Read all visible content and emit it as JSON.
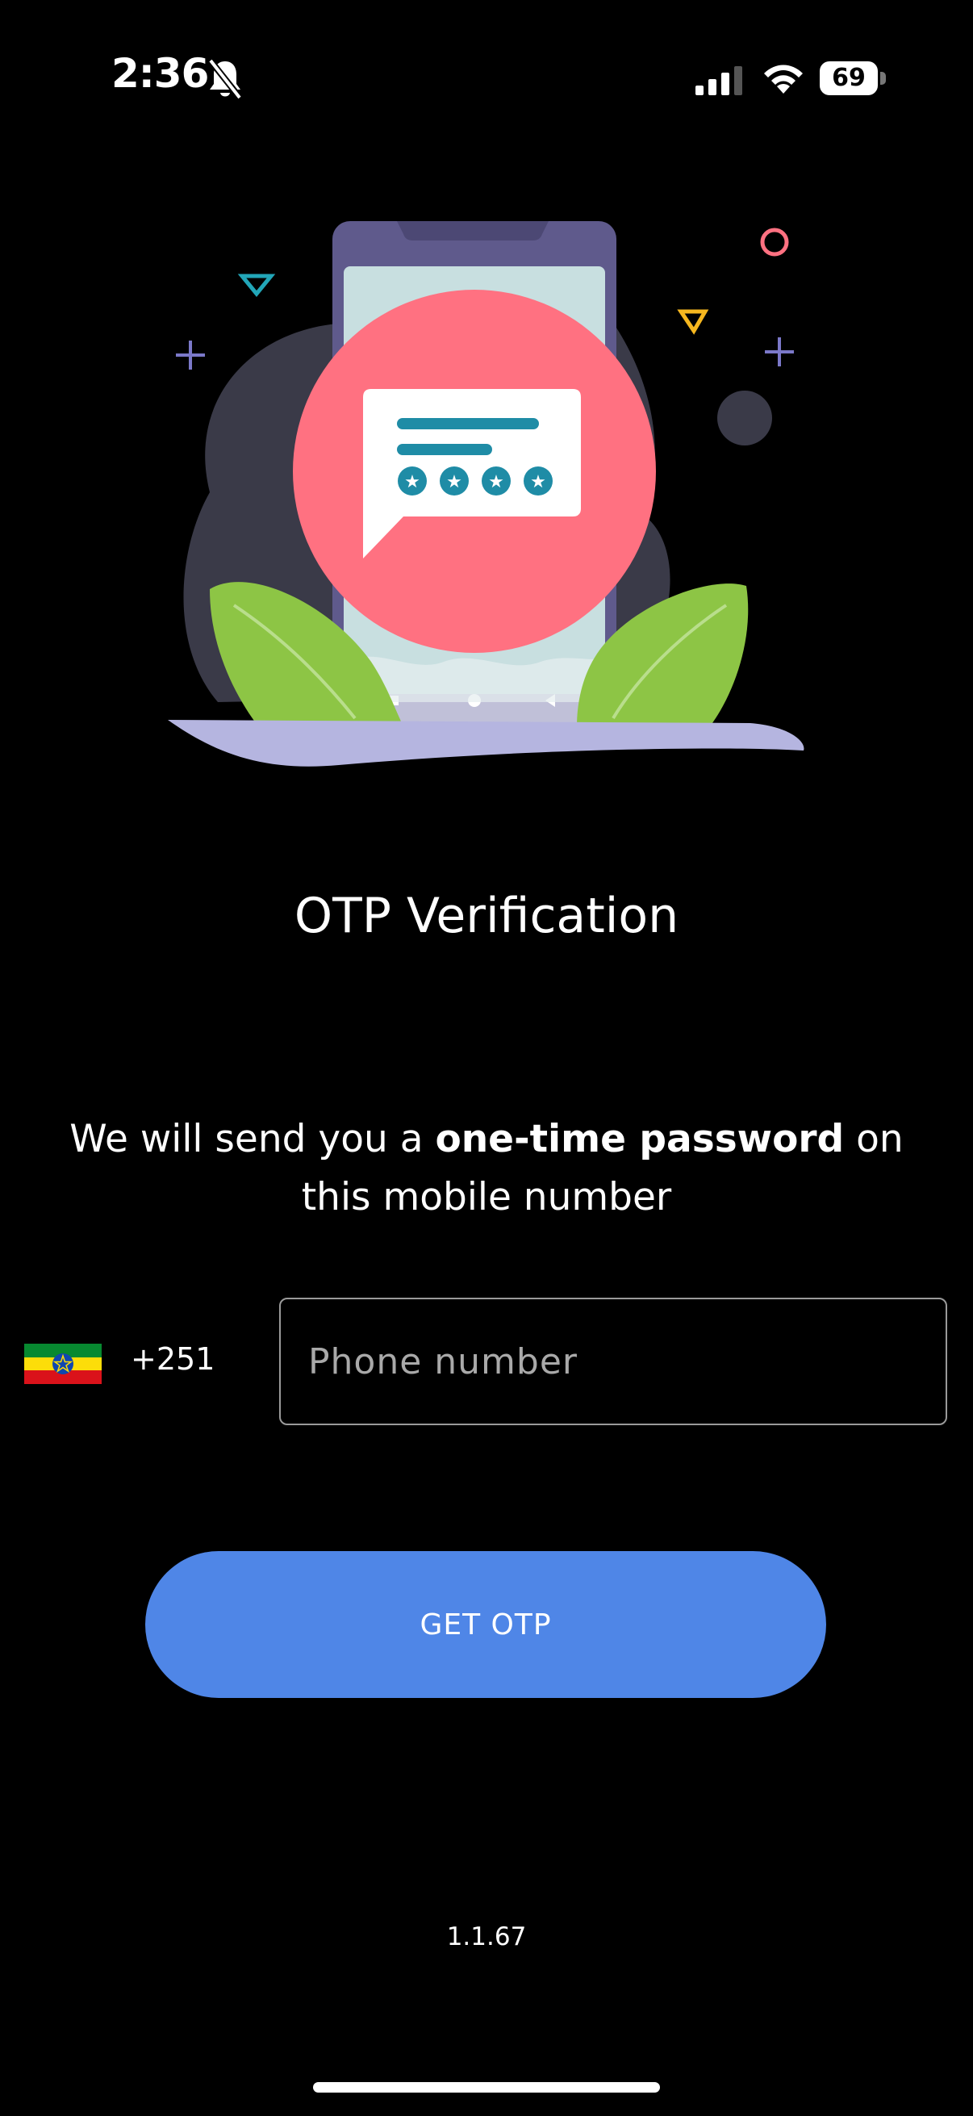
{
  "status_bar": {
    "time": "2:36",
    "battery": "69",
    "icons": [
      "bell-slash-icon",
      "cellular-signal-icon",
      "wifi-icon",
      "battery-icon"
    ]
  },
  "illustration": {
    "stars": [
      "★",
      "★",
      "★",
      "★"
    ],
    "colors": {
      "circle": "#ff7181",
      "phone": "#5f5a8c",
      "screen": "#c8dfe0",
      "leaf": "#8dc545",
      "base": "#b5b5e0",
      "blob": "#3a3a48"
    }
  },
  "otp": {
    "title": "OTP Verification",
    "description_prefix": "We will send you a ",
    "description_bold": "one-time password",
    "description_suffix": " on this mobile number"
  },
  "phone": {
    "country_code": "+251",
    "flag_icon": "ethiopia-flag-icon",
    "placeholder": "Phone number",
    "value": ""
  },
  "actions": {
    "get_otp_label": "GET OTP",
    "accent": "#4f86e7"
  },
  "app": {
    "version": "1.1.67"
  }
}
